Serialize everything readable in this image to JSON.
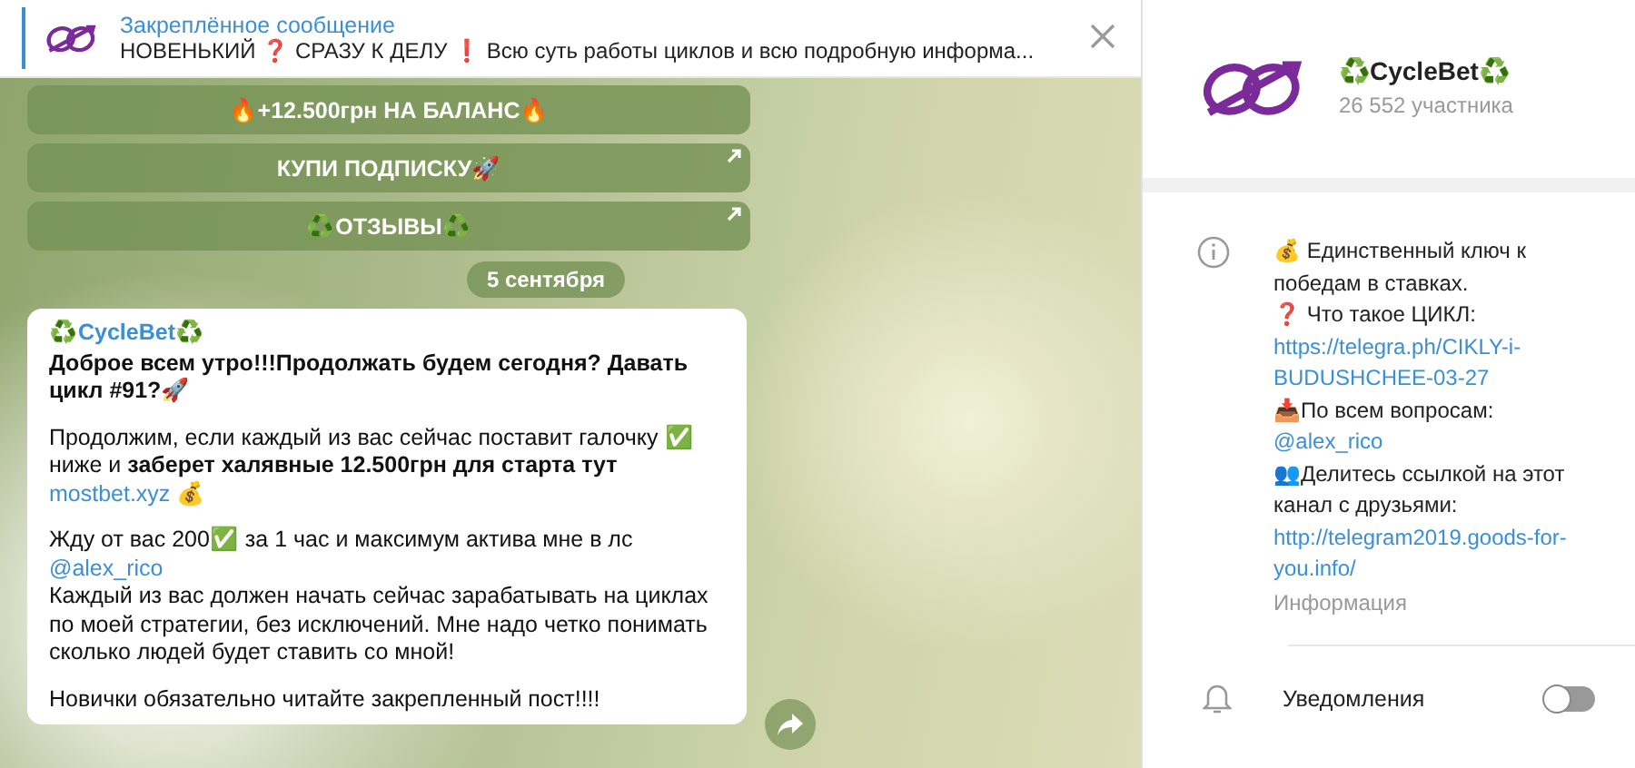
{
  "pinned": {
    "title": "Закреплённое сообщение",
    "text": "НОВЕНЬКИЙ ❓ СРАЗУ К ДЕЛУ ❗  Всю суть работы циклов и всю подробную информа..."
  },
  "keyboard": [
    {
      "label": "🔥+12.500грн НА БАЛАНС🔥",
      "kind": "plain"
    },
    {
      "label": "КУПИ ПОДПИСКУ🚀",
      "kind": "url"
    },
    {
      "label": "♻️ОТЗЫВЫ♻️",
      "kind": "url"
    }
  ],
  "date": "5 сентября",
  "message": {
    "sender": "♻️CycleBet♻️",
    "paragraphs": [
      [
        {
          "kind": "bold",
          "text": "Доброе всем утро!!!Продолжать будем сегодня? Давать цикл #91?🚀"
        }
      ],
      [
        {
          "kind": "text",
          "text": "Продолжим, если каждый из вас сейчас поставит галочку  ✅ ниже и  "
        },
        {
          "kind": "bold",
          "text": "заберет халявные 12.500грн для старта тут "
        },
        {
          "kind": "link",
          "text": "mostbet.xyz"
        },
        {
          "kind": "text",
          "text": "  💰"
        }
      ],
      [
        {
          "kind": "text",
          "text": "Жду от вас 200✅ за 1 час и максимум актива мне в лс "
        },
        {
          "kind": "link",
          "text": "@alex_rico"
        },
        {
          "kind": "break"
        },
        {
          "kind": "text",
          "text": "Каждый из вас должен начать сейчас зарабатывать на циклах по моей стратегии, без исключений. Мне надо четко понимать сколько людей будет ставить со мной!"
        }
      ],
      [
        {
          "kind": "text",
          "text": "Новички обязательно читайте закрепленный пост!!!!"
        }
      ]
    ]
  },
  "channel": {
    "name": "♻️CycleBet♻️",
    "members": "26 552 участника"
  },
  "info": {
    "lines": [
      {
        "kind": "text",
        "text": "💰 Единственный ключ к победам в ставках."
      },
      {
        "kind": "text",
        "text": "❓ Что такое ЦИКЛ:"
      },
      {
        "kind": "link",
        "text": "https://telegra.ph/CIKLY-i-BUDUSHCHEE-03-27"
      },
      {
        "kind": "text",
        "text": "📥По всем вопросам:"
      },
      {
        "kind": "link",
        "text": "@alex_rico"
      },
      {
        "kind": "text",
        "text": "👥Делитесь ссылкой на этот канал с друзьями:"
      },
      {
        "kind": "link",
        "text": "http://telegram2019.goods-for-you.info/"
      }
    ],
    "caption": "Информация"
  },
  "notifications": {
    "label": "Уведомления",
    "on": false
  }
}
